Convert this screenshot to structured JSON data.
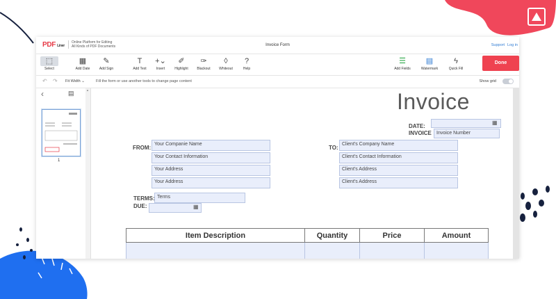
{
  "app": {
    "logo_text": "PDF",
    "logo_sub": "Liner",
    "tagline_1": "Online Platform for Editing",
    "tagline_2": "All Kinds of PDF Documents",
    "document_title": "Invoice Form",
    "support_link": "Support",
    "login_link": "Log in"
  },
  "toolbar": {
    "select": "Select",
    "add_date": "Add Date",
    "add_sign": "Add Sign",
    "add_text": "Add Text",
    "insert": "Insert",
    "highlight": "Highlight",
    "blackout": "Blackout",
    "whiteout": "Whiteout",
    "help": "Help",
    "add_fields": "Add Fields",
    "watermark": "Watermark",
    "quick_fill": "Quick Fill",
    "done": "Done"
  },
  "subbar": {
    "fit": "Fit Width",
    "hint": "Fill the form or use another tools to change page content",
    "show_grid": "Show grid"
  },
  "sidebar": {
    "page_number": "1"
  },
  "invoice": {
    "title": "Invoice",
    "date_label": "DATE:",
    "invoice_label": "INVOICE",
    "invoice_number_placeholder": "Invoice Number",
    "from_label": "FROM:",
    "to_label": "TO:",
    "from_fields": [
      "Your Companie Name",
      "Your Contact Information",
      "Your Address",
      "Your Address"
    ],
    "to_fields": [
      "Client's Company Name",
      "Client's Contact Information",
      "Client's Address",
      "Client's Address"
    ],
    "terms_label": "TERMS:",
    "terms_value": "Terms",
    "due_label": "DUE:",
    "columns": [
      "Item Description",
      "Quantity",
      "Price",
      "Amount"
    ]
  }
}
